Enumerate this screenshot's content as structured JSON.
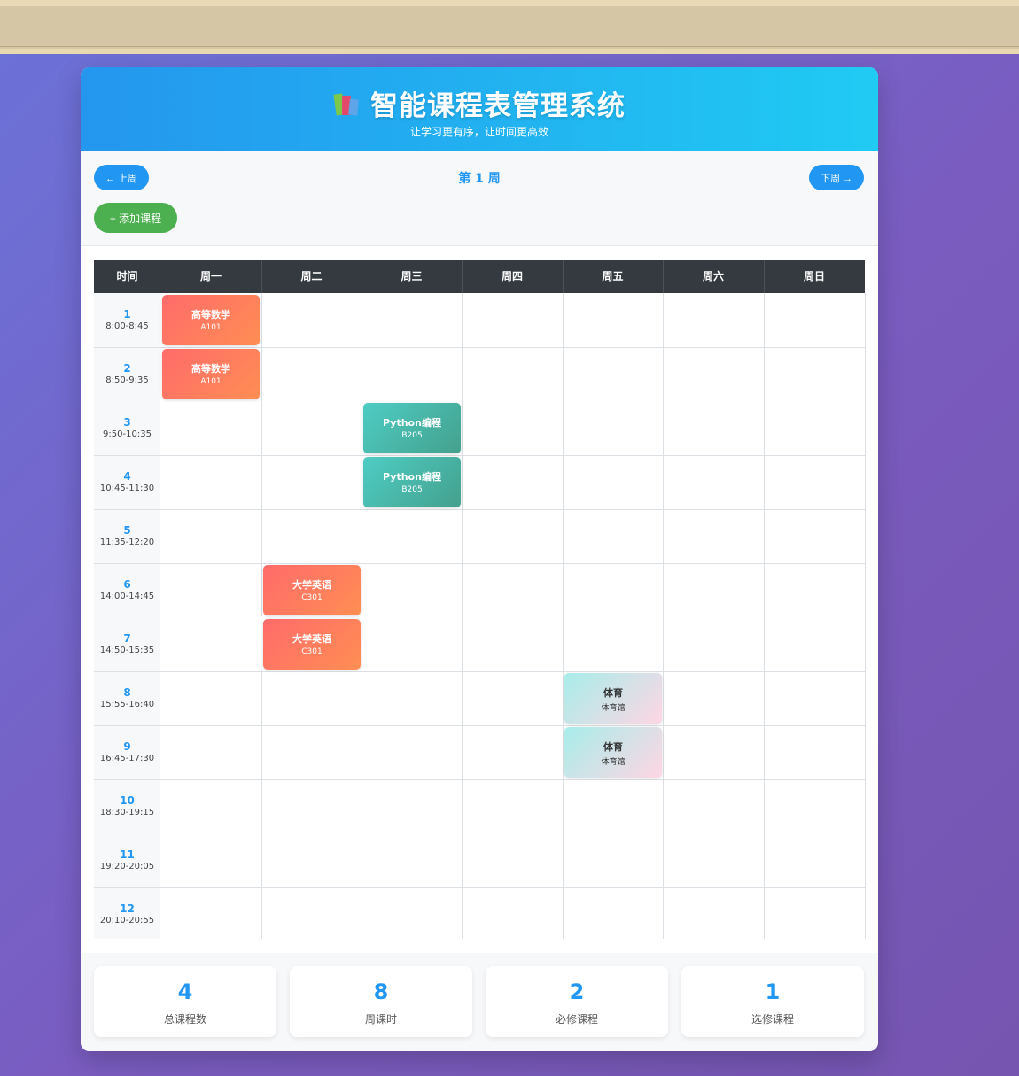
{
  "app": {
    "title": "智能课程表管理系统",
    "subtitle": "让学习更有序，让时间更高效",
    "icon": "books-icon"
  },
  "controls": {
    "prev_label": "← 上周",
    "next_label": "下周 →",
    "week_label": "第 1 周",
    "add_label": "+ 添加课程"
  },
  "table": {
    "headers": [
      "时间",
      "周一",
      "周二",
      "周三",
      "周四",
      "周五",
      "周六",
      "周日"
    ],
    "periods": [
      {
        "num": "1",
        "range": "8:00-8:45"
      },
      {
        "num": "2",
        "range": "8:50-9:35"
      },
      {
        "num": "3",
        "range": "9:50-10:35"
      },
      {
        "num": "4",
        "range": "10:45-11:30"
      },
      {
        "num": "5",
        "range": "11:35-12:20"
      },
      {
        "num": "6",
        "range": "14:00-14:45"
      },
      {
        "num": "7",
        "range": "14:50-15:35"
      },
      {
        "num": "8",
        "range": "15:55-16:40"
      },
      {
        "num": "9",
        "range": "16:45-17:30"
      },
      {
        "num": "10",
        "range": "18:30-19:15"
      },
      {
        "num": "11",
        "range": "19:20-20:05"
      },
      {
        "num": "12",
        "range": "20:10-20:55"
      }
    ]
  },
  "courses": [
    {
      "name": "高等数学",
      "room": "A101",
      "day": "周一",
      "period": "1",
      "color": "#ff7a5c"
    },
    {
      "name": "高等数学",
      "room": "A101",
      "day": "周一",
      "period": "2",
      "color": "#ff7a5c"
    },
    {
      "name": "Python编程",
      "room": "B205",
      "day": "周三",
      "period": "3",
      "color": "#4db8aa"
    },
    {
      "name": "Python编程",
      "room": "B205",
      "day": "周三",
      "period": "4",
      "color": "#4db8aa"
    },
    {
      "name": "大学英语",
      "room": "C301",
      "day": "周二",
      "period": "6",
      "color": "#ff7a5c"
    },
    {
      "name": "大学英语",
      "room": "C301",
      "day": "周二",
      "period": "7",
      "color": "#ff7a5c"
    },
    {
      "name": "体育",
      "room": "体育馆",
      "day": "周五",
      "period": "8",
      "color": "#cfe8ea"
    },
    {
      "name": "体育",
      "room": "体育馆",
      "day": "周五",
      "period": "9",
      "color": "#cfe8ea"
    }
  ],
  "stats": [
    {
      "value": "4",
      "label": "总课程数"
    },
    {
      "value": "8",
      "label": "周课时"
    },
    {
      "value": "2",
      "label": "必修课程"
    },
    {
      "value": "1",
      "label": "选修课程"
    }
  ],
  "colors": {
    "accent": "#2196f3",
    "add_button": "#4caf50",
    "table_header": "#343a40"
  }
}
